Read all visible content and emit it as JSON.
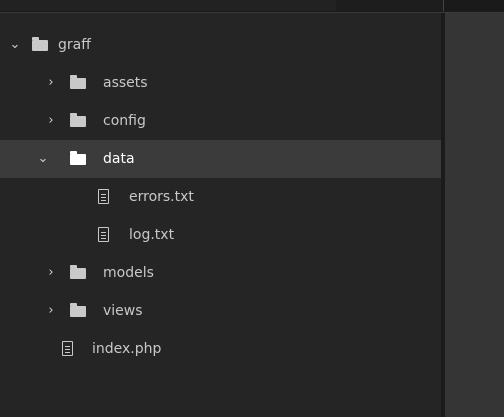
{
  "tree": {
    "items": [
      {
        "label": "graff",
        "kind": "folder",
        "state": "expanded",
        "selected": false,
        "icon": "folder-icon"
      },
      {
        "label": "assets",
        "kind": "folder",
        "state": "collapsed",
        "selected": false,
        "icon": "folder-icon"
      },
      {
        "label": "config",
        "kind": "folder",
        "state": "collapsed",
        "selected": false,
        "icon": "folder-icon"
      },
      {
        "label": "data",
        "kind": "folder",
        "state": "expanded",
        "selected": true,
        "icon": "folder-icon"
      },
      {
        "label": "errors.txt",
        "kind": "file",
        "selected": false,
        "icon": "file-icon"
      },
      {
        "label": "log.txt",
        "kind": "file",
        "selected": false,
        "icon": "file-icon"
      },
      {
        "label": "models",
        "kind": "folder",
        "state": "collapsed",
        "selected": false,
        "icon": "folder-icon"
      },
      {
        "label": "views",
        "kind": "folder",
        "state": "collapsed",
        "selected": false,
        "icon": "folder-icon"
      },
      {
        "label": "index.php",
        "kind": "file",
        "selected": false,
        "icon": "file-icon"
      }
    ]
  },
  "colors": {
    "sidebar_bg": "#252526",
    "selected_row_bg": "#3b3b3b",
    "editor_bg": "#353535",
    "text": "#c8c8c8"
  }
}
